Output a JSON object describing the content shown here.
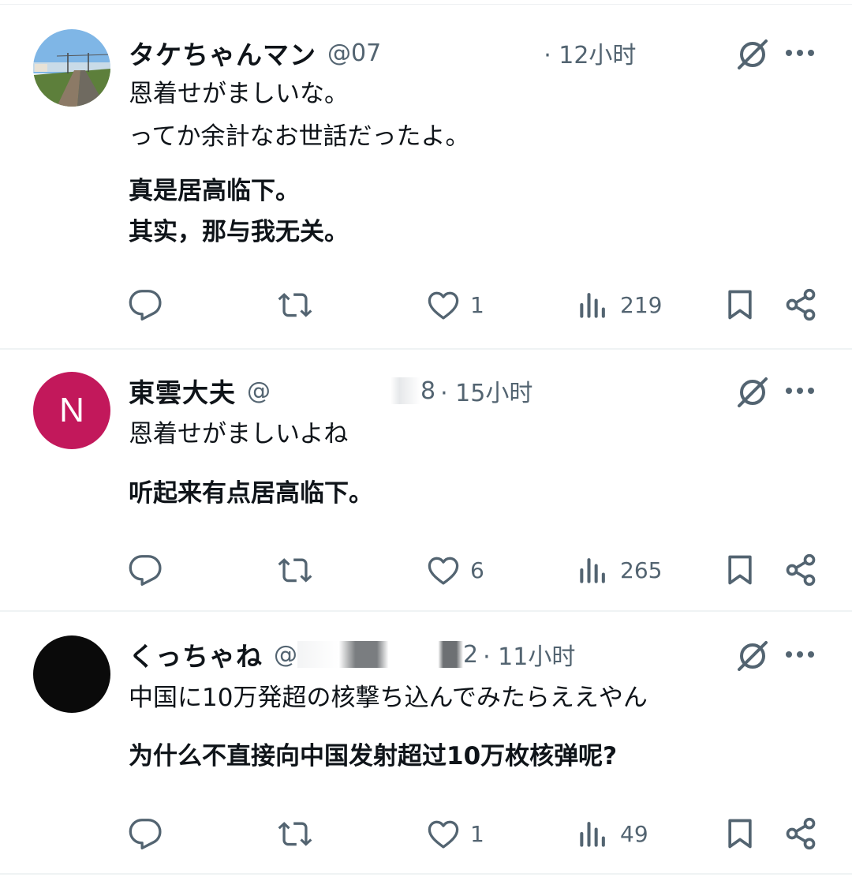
{
  "posts": [
    {
      "name": "タケちゃんマン",
      "handle_visible": "@07",
      "handle_tail": "",
      "time": "· 12小时",
      "text_lines": [
        "恩着せがましいな。",
        "ってか余計なお世話だったよ。"
      ],
      "translation_lines": [
        "真是居高临下。",
        "其实，那与我无关。"
      ],
      "likes": "1",
      "views": "219",
      "avatar_type": "photo"
    },
    {
      "name": "東雲大夫",
      "handle_visible": "@",
      "handle_tail": "8",
      "time": "· 15小时",
      "text_lines": [
        "恩着せがましいよね"
      ],
      "translation_lines": [
        "听起来有点居高临下。"
      ],
      "likes": "6",
      "views": "265",
      "avatar_type": "letter",
      "avatar_letter": "N",
      "avatar_color": "#c2185b"
    },
    {
      "name": "くっちゃね",
      "handle_visible": "@",
      "handle_tail": "2",
      "time": "· 11小时",
      "text_lines": [
        "中国に10万発超の核撃ち込んでみたらええやん"
      ],
      "translation_lines": [
        "为什么不直接向中国发射超过10万枚核弹呢?"
      ],
      "likes": "1",
      "views": "49",
      "avatar_type": "solid",
      "avatar_color": "#0a0a0a"
    }
  ],
  "icons": {
    "reply": "reply-icon",
    "repost": "repost-icon",
    "like": "heart-icon",
    "views": "views-chart-icon",
    "bookmark": "bookmark-icon",
    "share": "share-icon",
    "grok": "grok-icon",
    "more": "more-icon"
  },
  "colors": {
    "secondary_text": "#536471",
    "divider": "#eff3f4"
  }
}
